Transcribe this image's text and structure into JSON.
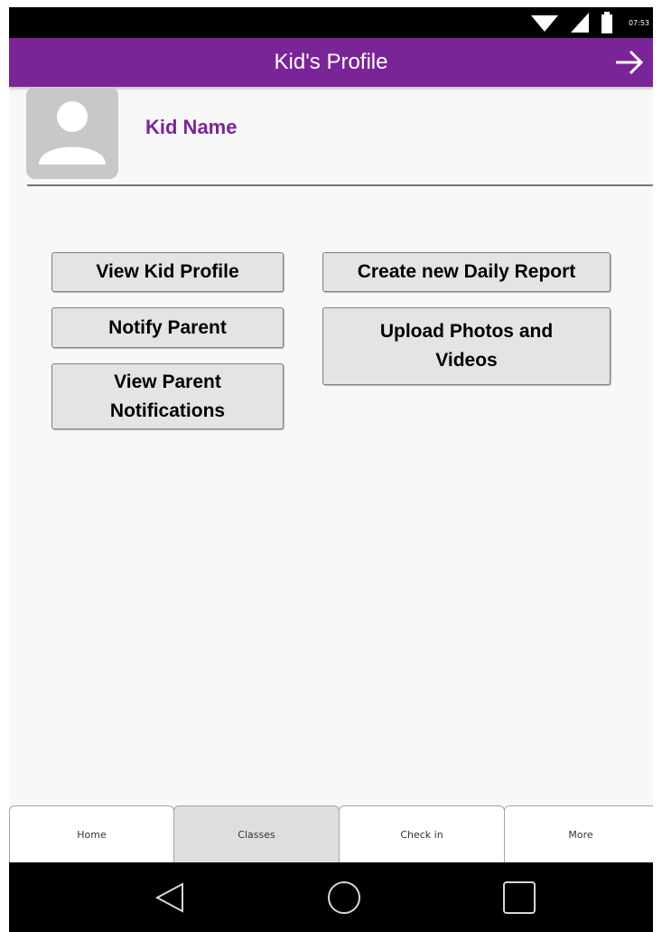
{
  "status_bar": {
    "time": "07:53",
    "icons": [
      "wifi-icon",
      "signal-icon",
      "battery-icon"
    ]
  },
  "app_bar": {
    "title": "Kid's Profile",
    "action_icon": "arrow-right-icon"
  },
  "profile": {
    "avatar_icon": "person-icon",
    "name": "Kid Name"
  },
  "actions": {
    "view_kid_profile": "View Kid Profile",
    "notify_parent": "Notify Parent",
    "view_parent_notifications": "View Parent Notifications",
    "create_daily_report": "Create new Daily Report",
    "upload_media": "Upload Photos and Videos"
  },
  "tabs": [
    {
      "label": "Home",
      "active": false
    },
    {
      "label": "Classes",
      "active": true
    },
    {
      "label": "Check in",
      "active": false
    },
    {
      "label": "More",
      "active": false
    }
  ],
  "nav_bar": {
    "icons": [
      "back-triangle-icon",
      "home-circle-icon",
      "recents-square-icon"
    ]
  },
  "colors": {
    "brand": "#7a2597",
    "button_bg": "#e4e4e4",
    "active_tab": "#dedede"
  }
}
